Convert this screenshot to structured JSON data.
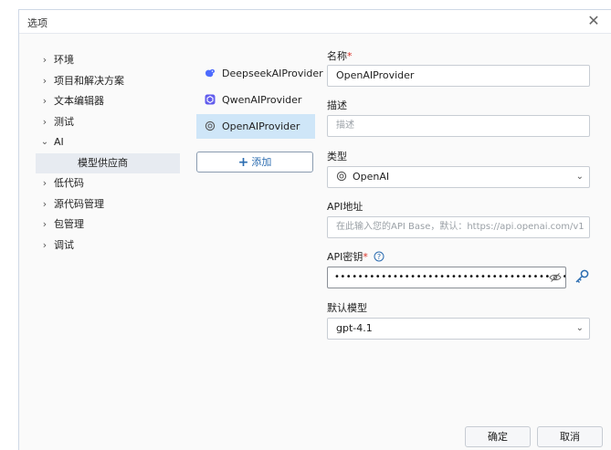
{
  "window": {
    "title": "选项",
    "close_glyph": "✕"
  },
  "tree": {
    "items": [
      {
        "label": "环境",
        "expanded": false
      },
      {
        "label": "项目和解决方案",
        "expanded": false
      },
      {
        "label": "文本编辑器",
        "expanded": false
      },
      {
        "label": "测试",
        "expanded": false
      },
      {
        "label": "AI",
        "expanded": true
      },
      {
        "label": "模型供应商",
        "child": true,
        "selected": true
      },
      {
        "label": "低代码",
        "expanded": false
      },
      {
        "label": "源代码管理",
        "expanded": false
      },
      {
        "label": "包管理",
        "expanded": false
      },
      {
        "label": "调试",
        "expanded": false
      }
    ]
  },
  "providers": {
    "items": [
      {
        "label": "DeepseekAIProvider",
        "icon": "deepseek-icon"
      },
      {
        "label": "QwenAIProvider",
        "icon": "qwen-icon"
      },
      {
        "label": "OpenAIProvider",
        "icon": "openai-icon",
        "selected": true
      }
    ],
    "add_label": "添加"
  },
  "form": {
    "name_label": "名称",
    "name_value": "OpenAIProvider",
    "desc_label": "描述",
    "desc_placeholder": "描述",
    "type_label": "类型",
    "type_value": "OpenAI",
    "api_addr_label": "API地址",
    "api_addr_placeholder": "在此输入您的API Base，默认：https://api.openai.com/v1",
    "api_key_label": "API密钥",
    "api_key_masked": "••••••••••••••••••••••••••••••••••••••••",
    "model_label": "默认模型",
    "model_value": "gpt-4.1",
    "required_mark": "*"
  },
  "footer": {
    "ok_label": "确定",
    "cancel_label": "取消"
  },
  "colors": {
    "accent": "#2b6cb0",
    "selected_provider_bg": "#cfe6f8",
    "required": "#d93025"
  }
}
